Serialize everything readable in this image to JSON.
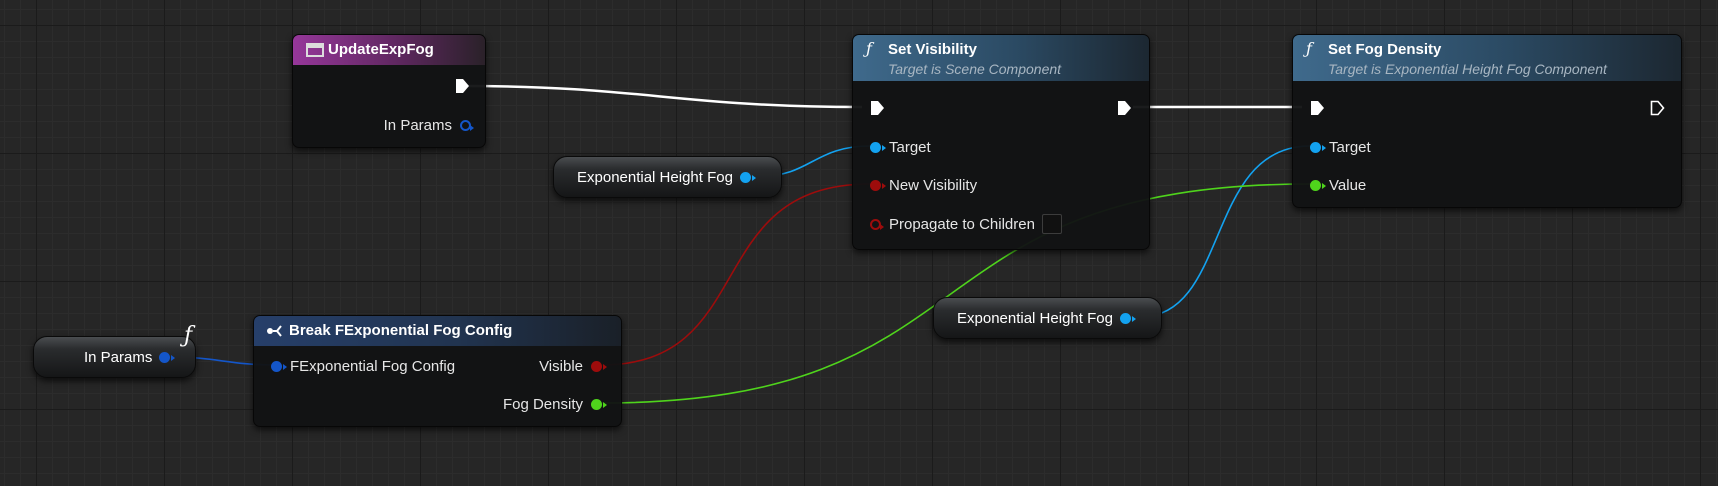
{
  "colors": {
    "exec": "#ffffff",
    "object_pin": "#13a2f0",
    "struct_pin": "#1456c9",
    "bool_pin": "#9d0c0c",
    "float_pin": "#4fd41c"
  },
  "nodes": {
    "update_exp_fog": {
      "title": "UpdateExpFog",
      "icon": "event-icon",
      "pins": {
        "in_params": "In Params"
      }
    },
    "set_visibility": {
      "title": "Set Visibility",
      "subtitle": "Target is Scene Component",
      "icon": "function-icon",
      "pins": {
        "target": "Target",
        "new_visibility": "New Visibility",
        "propagate": "Propagate to Children"
      }
    },
    "set_fog_density": {
      "title": "Set Fog Density",
      "subtitle": "Target is Exponential Height Fog Component",
      "icon": "function-icon",
      "pins": {
        "target": "Target",
        "value": "Value"
      }
    },
    "break_config": {
      "title": "Break FExponential Fog Config",
      "icon": "break-struct-icon",
      "pins": {
        "input": "FExponential Fog Config",
        "visible": "Visible",
        "fog_density": "Fog Density"
      }
    },
    "fog_var_1": {
      "label": "Exponential Height Fog"
    },
    "fog_var_2": {
      "label": "Exponential Height Fog"
    },
    "in_params_var": {
      "label": "In Params",
      "badge": "ƒ"
    }
  }
}
